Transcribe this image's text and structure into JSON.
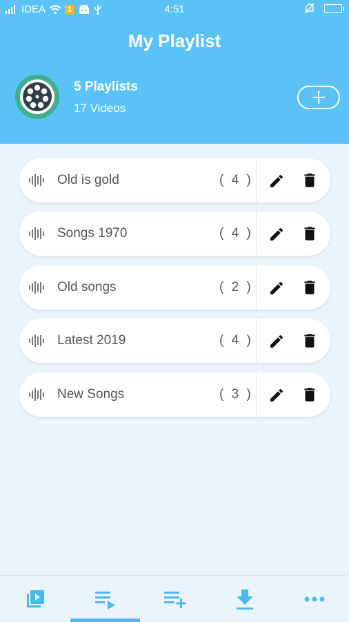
{
  "status": {
    "carrier": "IDEA",
    "badge": "1",
    "time": "4:51"
  },
  "header": {
    "title": "My Playlist",
    "summary_count": "5 Playlists",
    "summary_videos": "17 Videos"
  },
  "colors": {
    "header_bg": "#5ac2f7",
    "page_bg": "#eaf4fc",
    "accent": "#4fb7f0"
  },
  "playlists": [
    {
      "name": "Old is gold",
      "count": "( 4 )"
    },
    {
      "name": "Songs 1970",
      "count": "( 4 )"
    },
    {
      "name": "Old songs",
      "count": "( 2 )"
    },
    {
      "name": "Latest 2019",
      "count": "( 4 )"
    },
    {
      "name": "New Songs",
      "count": "( 3 )"
    }
  ],
  "tabs": [
    {
      "icon": "video-library-icon"
    },
    {
      "icon": "playlist-play-icon",
      "selected": true
    },
    {
      "icon": "playlist-add-icon"
    },
    {
      "icon": "download-icon"
    },
    {
      "icon": "more-icon"
    }
  ]
}
